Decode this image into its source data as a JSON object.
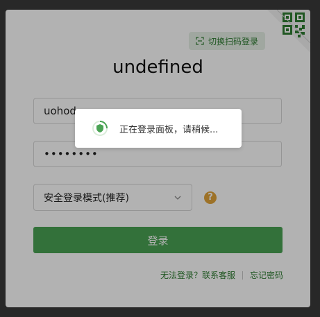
{
  "app": {
    "title": "undefined"
  },
  "qr_switch": {
    "label": "切换扫码登录"
  },
  "form": {
    "username_value": "uohod",
    "password_value": "••••••••",
    "mode_select_value": "安全登录模式(推荐)",
    "help_symbol": "?",
    "login_button_label": "登录"
  },
  "links": {
    "cannot_login": "无法登录？联系客服",
    "forgot_password": "忘记密码"
  },
  "toast": {
    "message": "正在登录面板，请稍候..."
  },
  "colors": {
    "brand_green": "#2e7d32",
    "button_green": "#4aa354",
    "help_orange": "#e1a43a",
    "overlay": "rgba(0,0,0,0.3)"
  }
}
